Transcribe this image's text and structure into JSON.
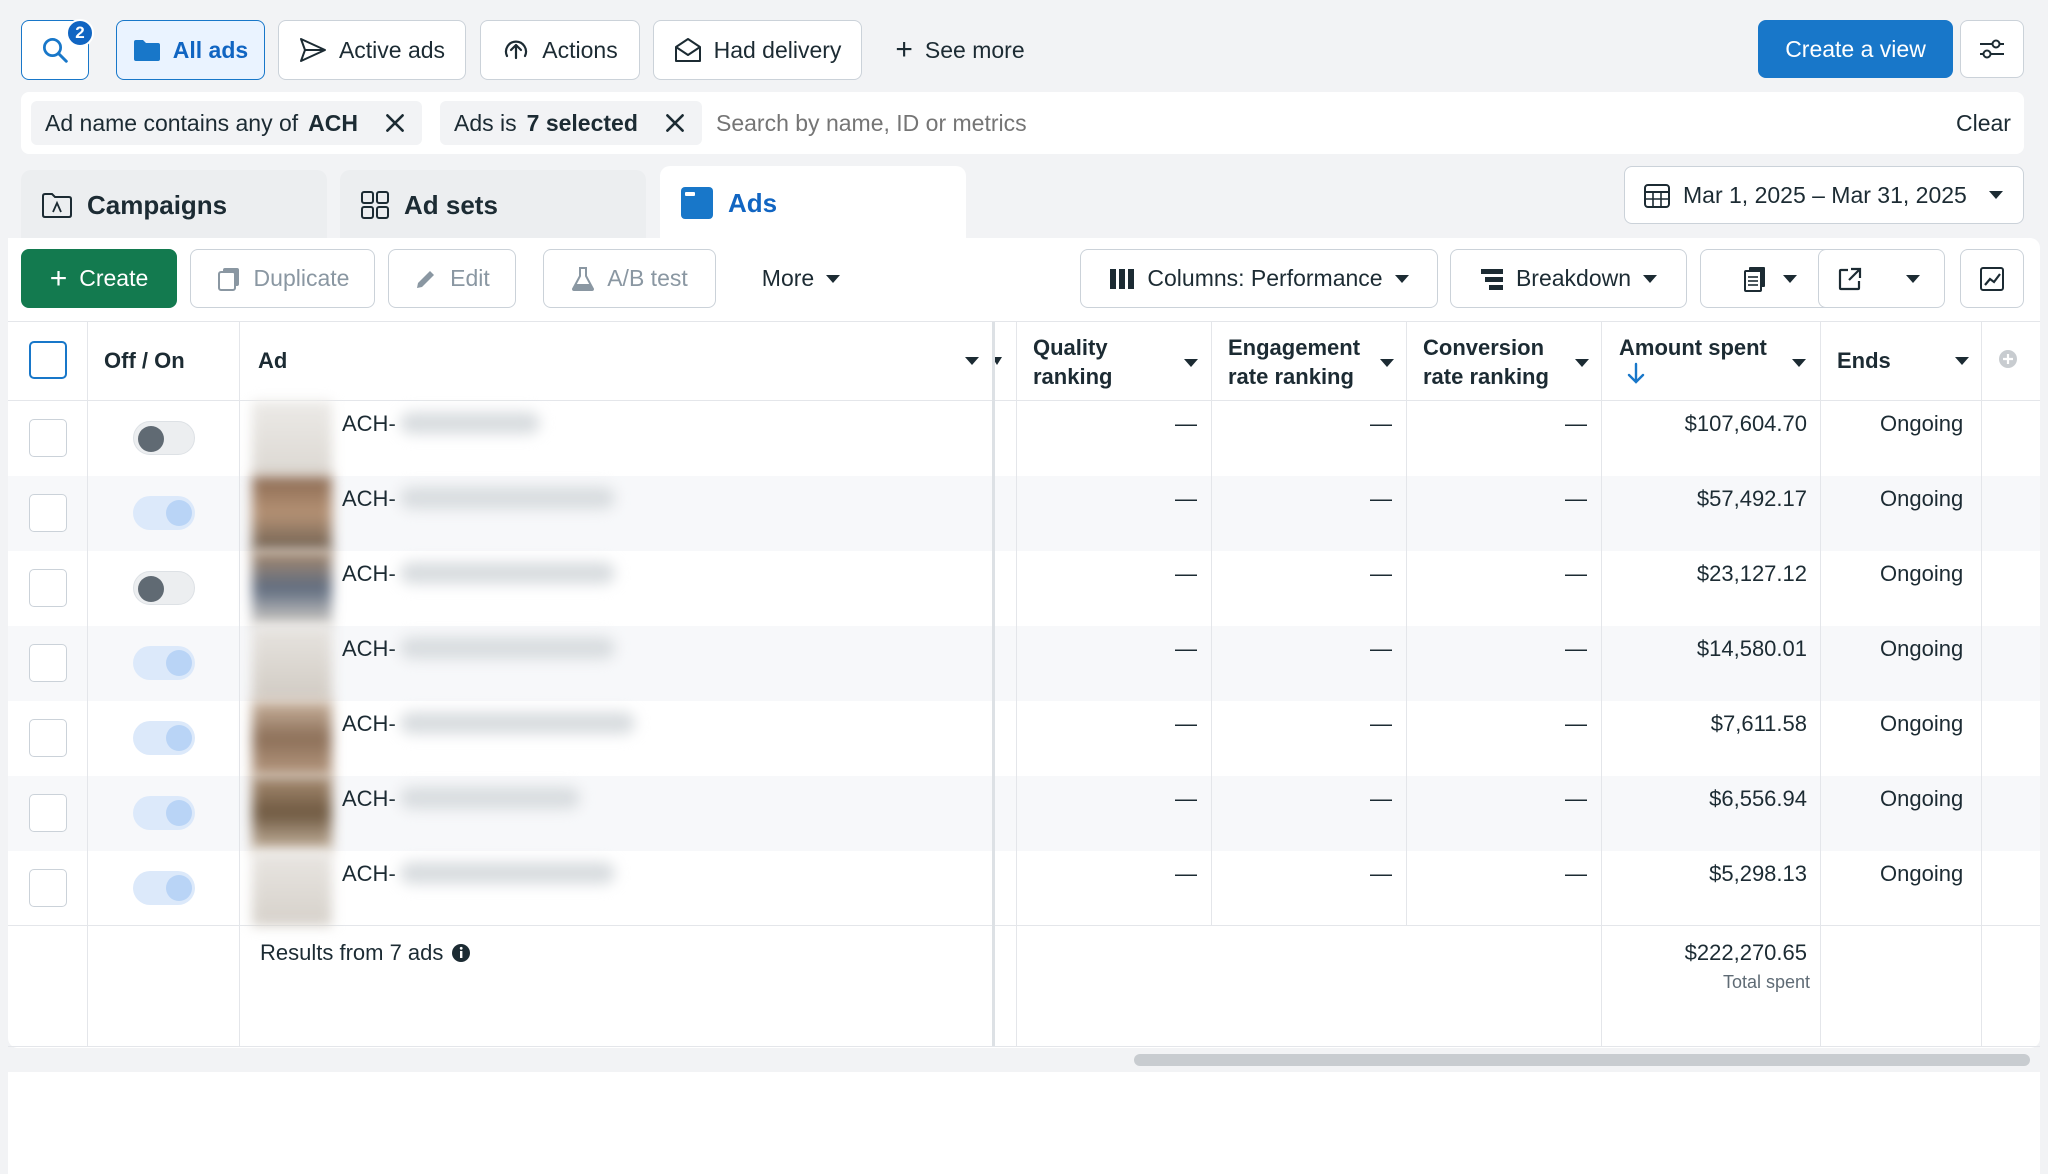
{
  "top_bar": {
    "search_badge": "2",
    "view_buttons": [
      "All ads",
      "Active ads",
      "Actions",
      "Had delivery",
      "See more"
    ],
    "create_view": "Create a view"
  },
  "filters": {
    "chip1_label": "Ad name contains any of",
    "chip1_value": "ACH",
    "chip2_label": "Ads is",
    "chip2_value": "7 selected",
    "search_placeholder": "Search by name, ID or metrics",
    "clear": "Clear"
  },
  "tabs": [
    "Campaigns",
    "Ad sets",
    "Ads"
  ],
  "date_range": "Mar 1, 2025 – Mar 31, 2025",
  "toolbar": {
    "create": "Create",
    "duplicate": "Duplicate",
    "edit": "Edit",
    "ab_test": "A/B test",
    "more": "More",
    "columns": "Columns: Performance",
    "breakdown": "Breakdown"
  },
  "table": {
    "headers": {
      "off_on": "Off / On",
      "ad": "Ad",
      "quality_1": "Quality",
      "quality_2": "ranking",
      "engagement_1": "Engagement",
      "engagement_2": "rate ranking",
      "conversion_1": "Conversion",
      "conversion_2": "rate ranking",
      "amount": "Amount spent",
      "ends": "Ends"
    },
    "rows": [
      {
        "name": "ACH-",
        "on": false,
        "quality": "—",
        "engagement": "—",
        "conversion": "—",
        "amount": "$107,604.70",
        "ends": "Ongoing"
      },
      {
        "name": "ACH-",
        "on": true,
        "quality": "—",
        "engagement": "—",
        "conversion": "—",
        "amount": "$57,492.17",
        "ends": "Ongoing"
      },
      {
        "name": "ACH-",
        "on": false,
        "quality": "—",
        "engagement": "—",
        "conversion": "—",
        "amount": "$23,127.12",
        "ends": "Ongoing"
      },
      {
        "name": "ACH-",
        "on": true,
        "quality": "—",
        "engagement": "—",
        "conversion": "—",
        "amount": "$14,580.01",
        "ends": "Ongoing"
      },
      {
        "name": "ACH-",
        "on": true,
        "quality": "—",
        "engagement": "—",
        "conversion": "—",
        "amount": "$7,611.58",
        "ends": "Ongoing"
      },
      {
        "name": "ACH-",
        "on": true,
        "quality": "—",
        "engagement": "—",
        "conversion": "—",
        "amount": "$6,556.94",
        "ends": "Ongoing"
      },
      {
        "name": "ACH-",
        "on": true,
        "quality": "—",
        "engagement": "—",
        "conversion": "—",
        "amount": "$5,298.13",
        "ends": "Ongoing"
      }
    ],
    "footer": {
      "results": "Results from 7 ads",
      "total": "$222,270.65",
      "total_label": "Total spent"
    }
  },
  "colors": {
    "accent": "#1877c9",
    "create_green": "#137a4f"
  }
}
